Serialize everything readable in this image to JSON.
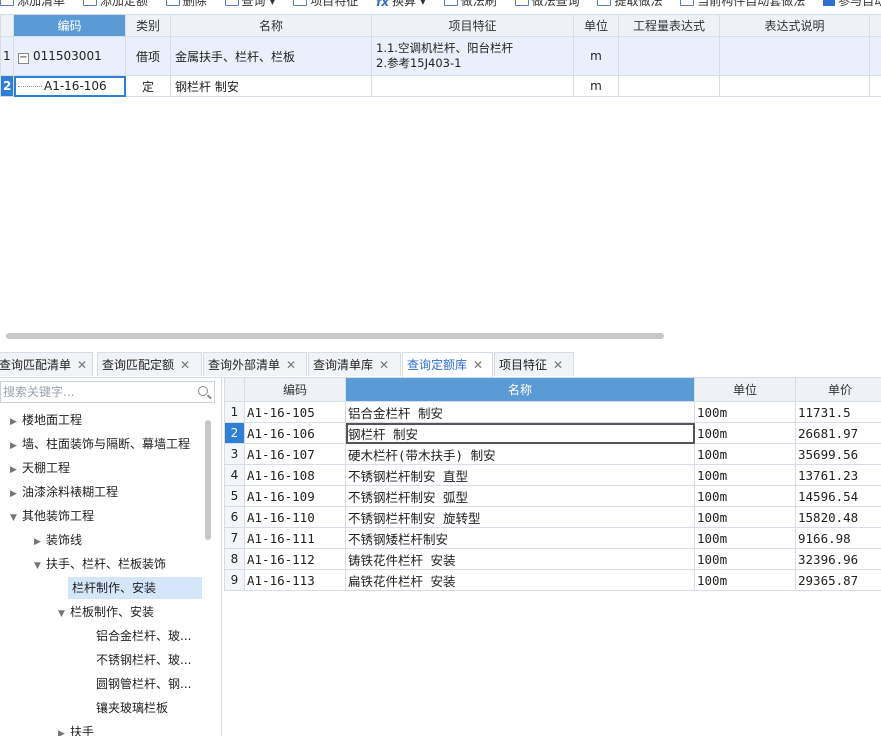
{
  "toolbar": {
    "add_list": "添加清单",
    "add_quota": "添加定额",
    "delete": "删除",
    "query": "查询",
    "item_feature": "项目特征",
    "convert": "换算",
    "method_brush": "做法刷",
    "method_query": "做法查询",
    "extract_method": "提取做法",
    "auto_apply": "当前构件自动套做法",
    "join_auto": "参与自动套"
  },
  "upper_grid": {
    "headers": [
      "编码",
      "类别",
      "名称",
      "项目特征",
      "单位",
      "工程量表达式",
      "表达式说明"
    ],
    "rows": [
      {
        "num": "1",
        "expander": "−",
        "code": "011503001",
        "type": "借项",
        "name": "金属扶手、栏杆、栏板",
        "feature_1": "1.1.空调机栏杆、阳台栏杆",
        "feature_2": "2.参考15J403-1",
        "unit": "m",
        "expr": "",
        "desc": ""
      },
      {
        "num": "2",
        "code": "A1-16-106",
        "type": "定",
        "name": "钢栏杆 制安",
        "feature": "",
        "unit": "m",
        "expr": "",
        "desc": ""
      }
    ]
  },
  "tabs": [
    {
      "label": "查询匹配清单"
    },
    {
      "label": "查询匹配定额"
    },
    {
      "label": "查询外部清单"
    },
    {
      "label": "查询清单库"
    },
    {
      "label": "查询定额库"
    },
    {
      "label": "项目特征"
    }
  ],
  "search": {
    "placeholder": "搜索关键字..."
  },
  "tree": [
    {
      "label": "楼地面工程"
    },
    {
      "label": "墙、柱面装饰与隔断、幕墙工程"
    },
    {
      "label": "天棚工程"
    },
    {
      "label": "油漆涂料裱糊工程"
    },
    {
      "label": "其他装饰工程"
    },
    {
      "label": "装饰线"
    },
    {
      "label": "扶手、栏杆、栏板装饰"
    },
    {
      "label": "栏杆制作、安装"
    },
    {
      "label": "栏板制作、安装"
    },
    {
      "label": "铝合金栏杆、玻..."
    },
    {
      "label": "不锈钢栏杆、玻..."
    },
    {
      "label": "圆钢管栏杆、钢..."
    },
    {
      "label": "镶夹玻璃栏板"
    },
    {
      "label": "扶手"
    }
  ],
  "lower_grid": {
    "headers": [
      "编码",
      "名称",
      "单位",
      "单价"
    ],
    "rows": [
      {
        "num": "1",
        "code": "A1-16-105",
        "name": "铝合金栏杆 制安",
        "unit": "100m",
        "price": "11731.5"
      },
      {
        "num": "2",
        "code": "A1-16-106",
        "name": "钢栏杆 制安",
        "unit": "100m",
        "price": "26681.97"
      },
      {
        "num": "3",
        "code": "A1-16-107",
        "name": "硬木栏杆(带木扶手) 制安",
        "unit": "100m",
        "price": "35699.56"
      },
      {
        "num": "4",
        "code": "A1-16-108",
        "name": "不锈钢栏杆制安 直型",
        "unit": "100m",
        "price": "13761.23"
      },
      {
        "num": "5",
        "code": "A1-16-109",
        "name": "不锈钢栏杆制安 弧型",
        "unit": "100m",
        "price": "14596.54"
      },
      {
        "num": "6",
        "code": "A1-16-110",
        "name": "不锈钢栏杆制安 旋转型",
        "unit": "100m",
        "price": "15820.48"
      },
      {
        "num": "7",
        "code": "A1-16-111",
        "name": "不锈钢矮栏杆制安",
        "unit": "100m",
        "price": "9166.98"
      },
      {
        "num": "8",
        "code": "A1-16-112",
        "name": "铸铁花件栏杆 安装",
        "unit": "100m",
        "price": "32396.96"
      },
      {
        "num": "9",
        "code": "A1-16-113",
        "name": "扁铁花件栏杆 安装",
        "unit": "100m",
        "price": "29365.87"
      }
    ]
  },
  "colors": {
    "accent": "#2f7fd6",
    "header_sel": "#5b9bd5",
    "row_hl": "#e8f1fb"
  }
}
